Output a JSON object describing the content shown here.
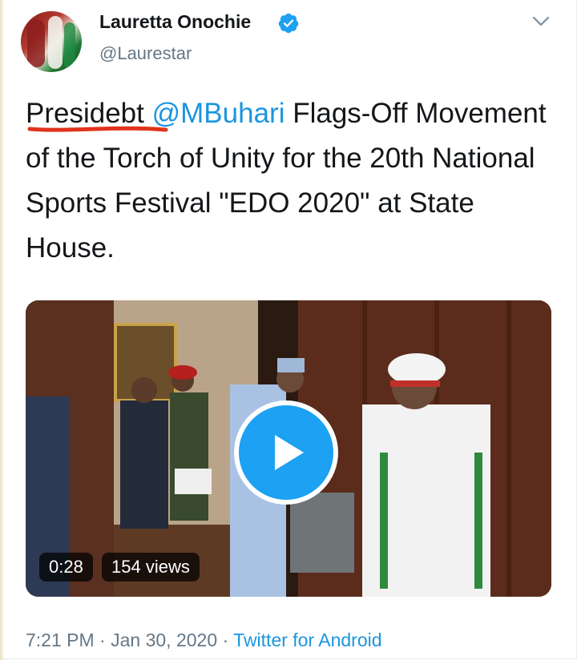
{
  "author": {
    "name": "Lauretta Onochie",
    "handle": "@Laurestar",
    "verified": true
  },
  "tweet": {
    "typo_word": "Presidebt",
    "mention": "@MBuhari",
    "text_after_mention": " Flags-Off Movement of the Torch of Unity for the 20th National Sports Festival \"EDO 2020\" at State House."
  },
  "video": {
    "duration": "0:28",
    "views": "154 views"
  },
  "meta": {
    "time": "7:21 PM",
    "separator": "·",
    "date": "Jan 30, 2020",
    "source": "Twitter for Android"
  },
  "colors": {
    "link": "#1b95e0",
    "verified": "#1da1f2",
    "annotation_underline": "#e0341c",
    "text": "#14171a",
    "muted": "#657786"
  },
  "icons": [
    "verified-badge-icon",
    "chevron-down-icon",
    "play-icon"
  ]
}
